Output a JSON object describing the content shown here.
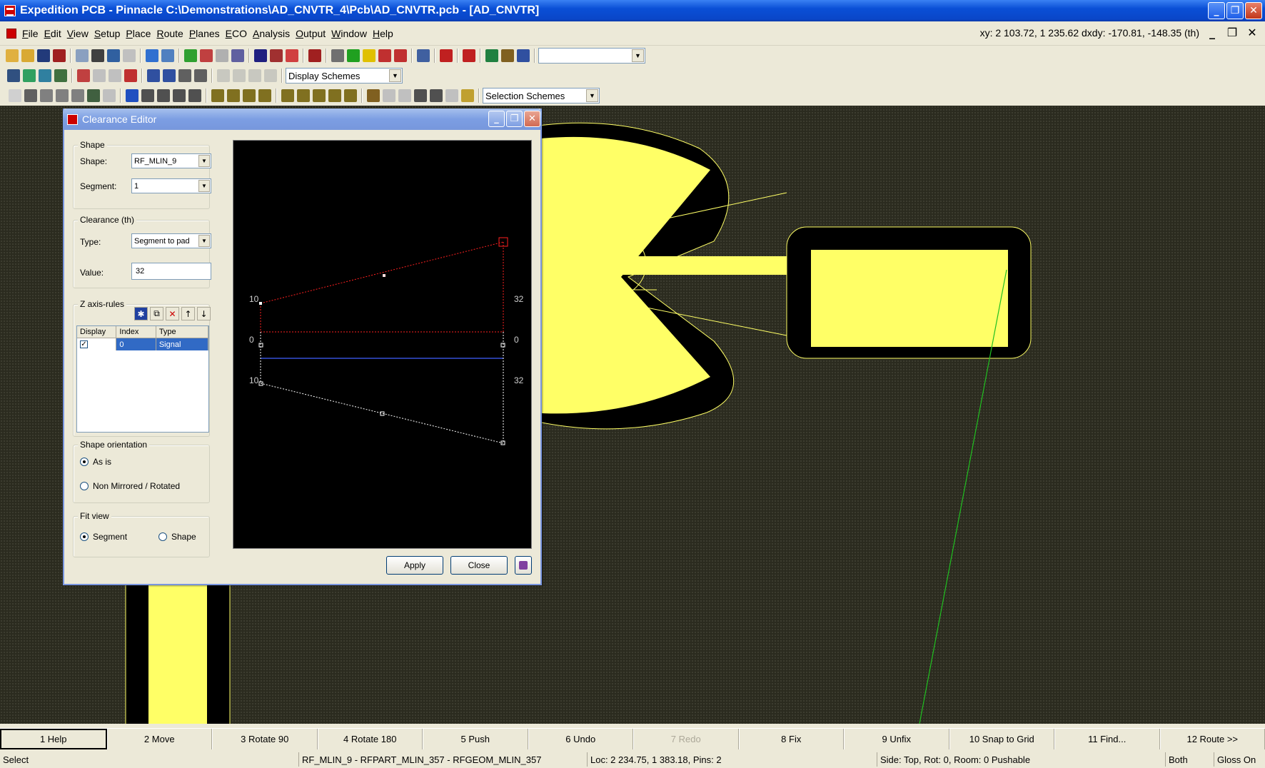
{
  "window": {
    "title": "Expedition PCB - Pinnacle  C:\\Demonstrations\\AD_CNVTR_4\\Pcb\\AD_CNVTR.pcb - [AD_CNVTR]",
    "min": "_",
    "max": "❐",
    "close": "✕"
  },
  "menu": [
    {
      "key": "F",
      "rest": "ile"
    },
    {
      "key": "E",
      "rest": "dit"
    },
    {
      "key": "V",
      "rest": "iew"
    },
    {
      "key": "S",
      "rest": "etup"
    },
    {
      "key": "P",
      "rest": "lace"
    },
    {
      "key": "R",
      "rest": "oute"
    },
    {
      "key": "P",
      "rest": "lanes"
    },
    {
      "key": "E",
      "rest": "CO"
    },
    {
      "key": "A",
      "rest": "nalysis"
    },
    {
      "key": "O",
      "rest": "utput"
    },
    {
      "key": "W",
      "rest": "indow"
    },
    {
      "key": "H",
      "rest": "elp"
    }
  ],
  "coords": "xy: 2 103.72, 1 235.62  dxdy: -170.81, -148.35  (th)",
  "toolbar": {
    "scheme_combo_1": "",
    "display_schemes": "Display Schemes",
    "selection_schemes": "Selection Schemes",
    "arrow": "▼"
  },
  "dialog": {
    "title": "Clearance Editor",
    "shape_group": "Shape",
    "shape_label": "Shape:",
    "shape_value": "RF_MLIN_9",
    "segment_label": "Segment:",
    "segment_value": "1",
    "clearance_group": "Clearance (th)",
    "type_label": "Type:",
    "type_value": "Segment to pad",
    "value_label": "Value:",
    "value_value": "32",
    "zaxis_group": "Z axis-rules",
    "zaxis_buttons": [
      "✱",
      "⧉",
      "✕",
      "↑",
      "↓"
    ],
    "table_headers": [
      "Display",
      "Index",
      "Type"
    ],
    "table_rows": [
      {
        "display": "✓",
        "index": "0",
        "type": "Signal"
      }
    ],
    "orientation_group": "Shape orientation",
    "orientation_as_is": "As is",
    "orientation_non_mirrored": "Non Mirrored / Rotated",
    "fitview_group": "Fit view",
    "fitview_segment": "Segment",
    "fitview_shape": "Shape",
    "apply": "Apply",
    "close": "Close",
    "preview_labels": {
      "left_top": "10",
      "left_mid": "0",
      "left_bot": "10",
      "right_top": "32",
      "right_mid": "0",
      "right_bot": "32"
    }
  },
  "fkeys": [
    {
      "label": "1 Help",
      "state": "active"
    },
    {
      "label": "2 Move",
      "state": "normal"
    },
    {
      "label": "3 Rotate 90",
      "state": "normal"
    },
    {
      "label": "4 Rotate 180",
      "state": "normal"
    },
    {
      "label": "5 Push",
      "state": "normal"
    },
    {
      "label": "6 Undo",
      "state": "normal"
    },
    {
      "label": "7 Redo",
      "state": "disabled"
    },
    {
      "label": "8 Fix",
      "state": "normal"
    },
    {
      "label": "9 Unfix",
      "state": "normal"
    },
    {
      "label": "10 Snap to Grid",
      "state": "normal"
    },
    {
      "label": "11 Find...",
      "state": "normal"
    },
    {
      "label": "12 Route >>",
      "state": "normal"
    }
  ],
  "status": {
    "mode": "Select",
    "object": "RF_MLIN_9 - RFPART_MLIN_357 - RFGEOM_MLIN_357",
    "loc": "Loc: 2 234.75, 1 383.18, Pins: 2",
    "side": "Side: Top, Rot: 0, Room: 0  Pushable",
    "both": "Both",
    "gloss": "Gloss On"
  },
  "colors": {
    "copper": "#ffff66",
    "board_bg": "#2b2b1f",
    "clearance_red": "#ff2020",
    "rat_green": "#20c020"
  }
}
